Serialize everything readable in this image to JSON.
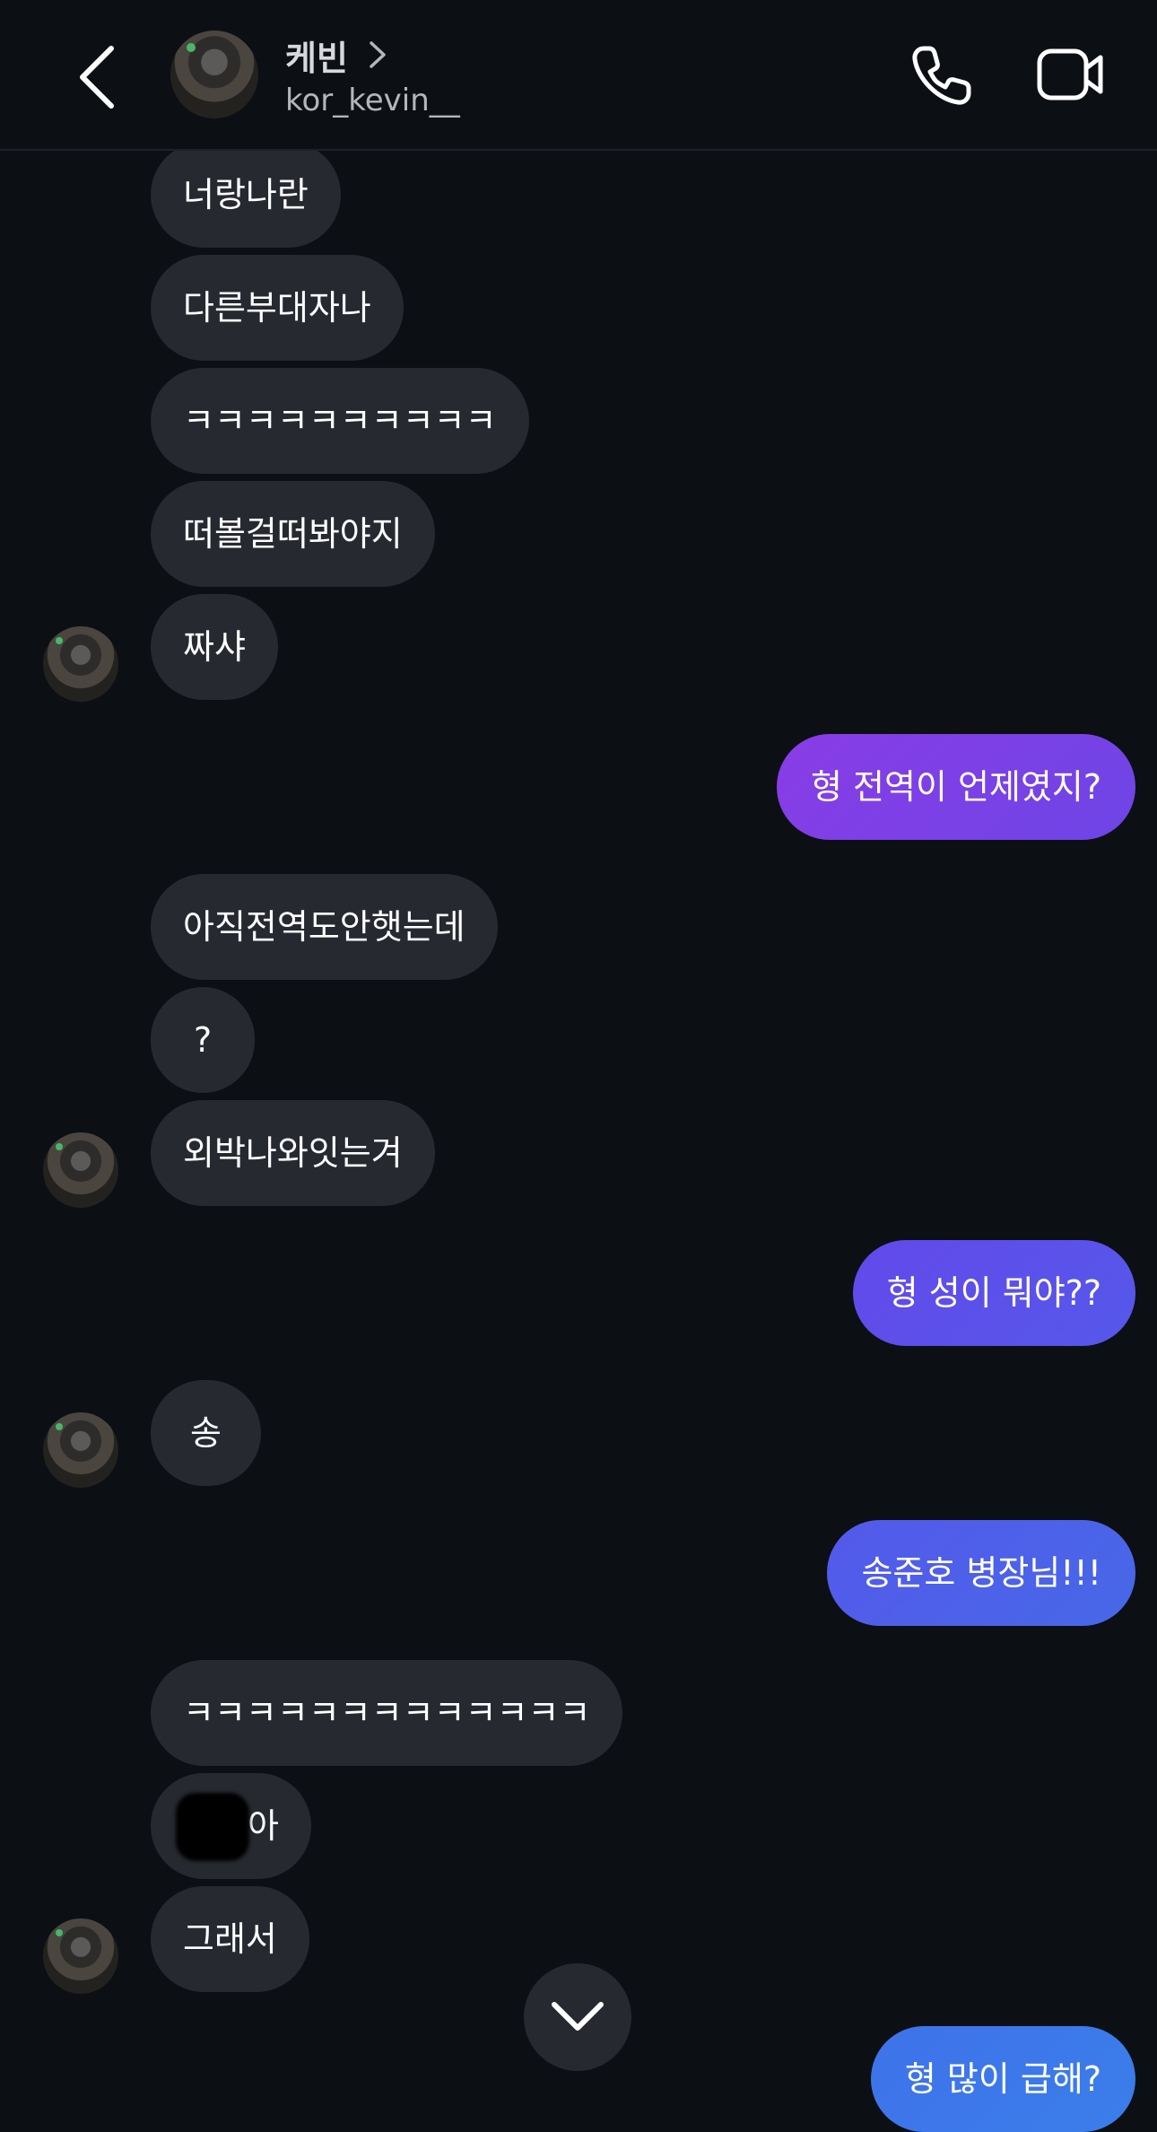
{
  "header": {
    "name": "케빈",
    "username": "kor_kevin__",
    "icons": {
      "back": "chevron-left-icon",
      "name_chevron": "chevron-right-icon",
      "call": "phone-icon",
      "video": "video-camera-icon"
    }
  },
  "messages": [
    {
      "text": "너랑나란",
      "from": "them"
    },
    {
      "text": "다른부대자나",
      "from": "them"
    },
    {
      "text": "ㅋㅋㅋㅋㅋㅋㅋㅋㅋㅋ",
      "from": "them"
    },
    {
      "text": "떠볼걸떠봐야지",
      "from": "them"
    },
    {
      "text": "짜샤",
      "from": "them"
    },
    {
      "text": "형 전역이 언제였지?",
      "from": "me"
    },
    {
      "text": "아직전역도안햇는데",
      "from": "them"
    },
    {
      "text": "?",
      "from": "them"
    },
    {
      "text": "외박나와잇는겨",
      "from": "them"
    },
    {
      "text": "형 성이 뭐야??",
      "from": "me"
    },
    {
      "text": "송",
      "from": "them"
    },
    {
      "text": "송준호 병장님!!!",
      "from": "me"
    },
    {
      "text": "ㅋㅋㅋㅋㅋㅋㅋㅋㅋㅋㅋㅋㅋ",
      "from": "them"
    },
    {
      "text": "아",
      "from": "them",
      "redacted_prefix": true
    },
    {
      "text": "그래서",
      "from": "them"
    },
    {
      "text": "형 많이 급해?",
      "from": "me"
    }
  ],
  "colors": {
    "background": "#0c0f14",
    "incoming_bubble": "#262a30",
    "outgoing_gradient": [
      "#7b3fe4",
      "#5a52ea",
      "#4b62e6",
      "#3a78ea"
    ]
  },
  "scroll_button_icon": "chevron-down-icon"
}
